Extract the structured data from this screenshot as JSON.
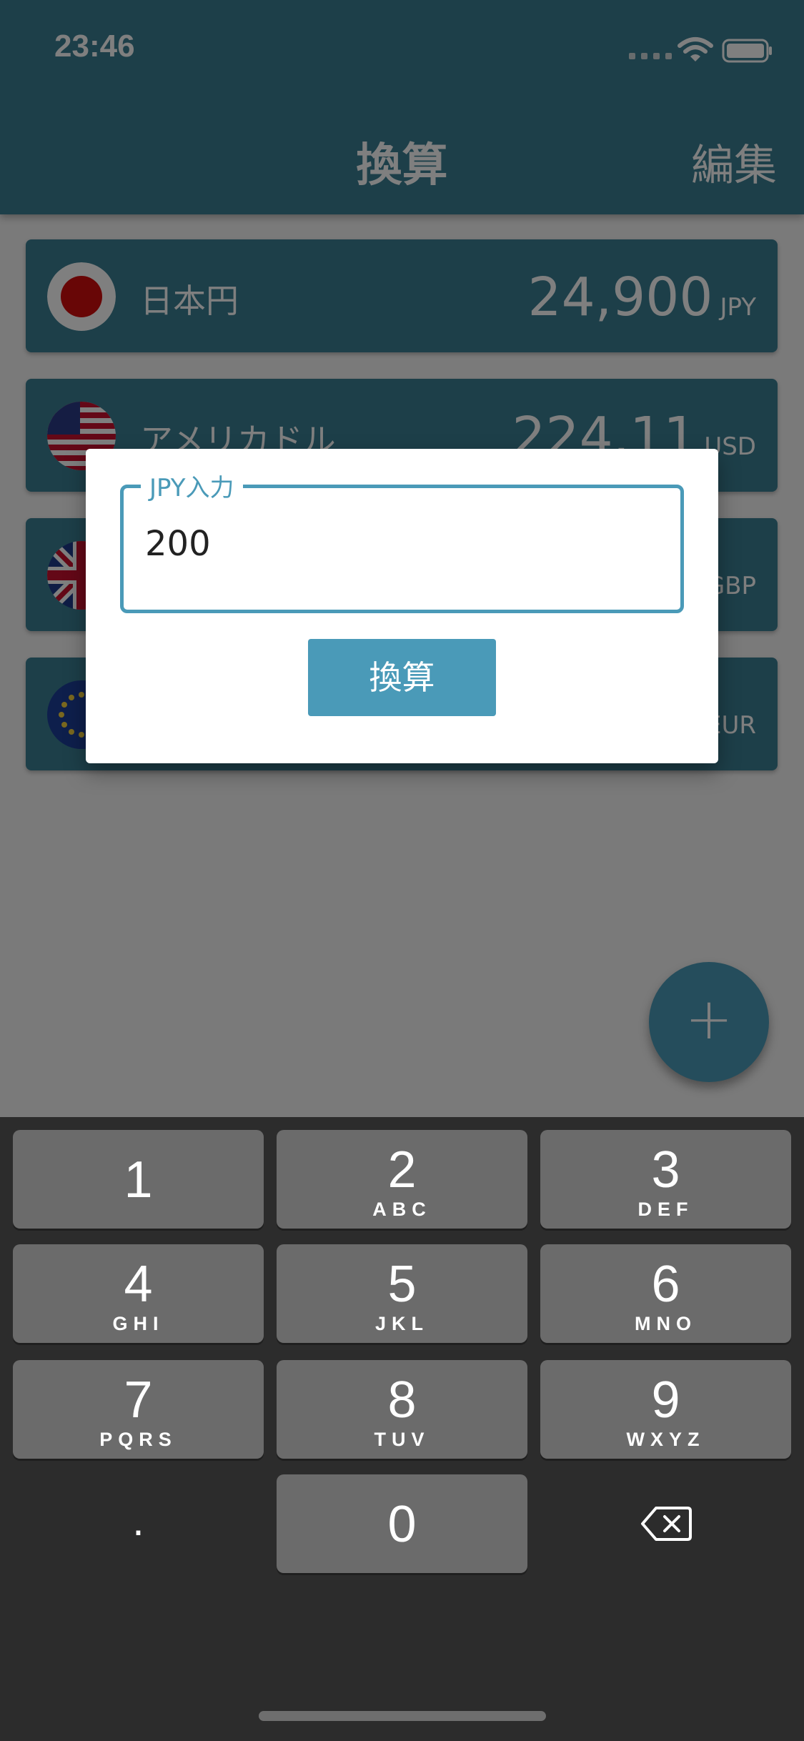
{
  "status_bar": {
    "time": "23:46"
  },
  "nav": {
    "title": "換算",
    "edit_label": "編集"
  },
  "currencies": [
    {
      "name": "日本円",
      "amount": "24,900",
      "code": "JPY",
      "flag": "japan-flag"
    },
    {
      "name": "アメリカドル",
      "amount": "224.11",
      "code": "USD",
      "flag": "us-flag"
    },
    {
      "name": "",
      "amount": "",
      "code": "GBP",
      "flag": "uk-flag"
    },
    {
      "name": "",
      "amount": "",
      "code": "EUR",
      "flag": "eu-flag"
    }
  ],
  "fab": {
    "label": "+"
  },
  "dialog": {
    "field_label": "JPY入力",
    "field_value": "200",
    "button_label": "換算"
  },
  "keypad": {
    "keys": [
      {
        "digit": "1",
        "letters": ""
      },
      {
        "digit": "2",
        "letters": "ABC"
      },
      {
        "digit": "3",
        "letters": "DEF"
      },
      {
        "digit": "4",
        "letters": "GHI"
      },
      {
        "digit": "5",
        "letters": "JKL"
      },
      {
        "digit": "6",
        "letters": "MNO"
      },
      {
        "digit": "7",
        "letters": "PQRS"
      },
      {
        "digit": "8",
        "letters": "TUV"
      },
      {
        "digit": "9",
        "letters": "WXYZ"
      },
      {
        "digit": "0",
        "letters": ""
      }
    ],
    "decimal": ".",
    "delete_icon": "backspace-icon"
  },
  "colors": {
    "header": "#3a7f93",
    "accent": "#4a9ab8",
    "keyboard_bg": "#2c2c2c",
    "key_bg": "#6b6b6b"
  }
}
